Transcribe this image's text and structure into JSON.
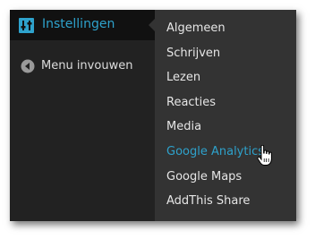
{
  "sidebar": {
    "active_item": {
      "label": "Instellingen",
      "icon": "settings-sliders-icon"
    },
    "items": [
      {
        "label": "Menu invouwen",
        "icon": "collapse-arrow-icon"
      }
    ]
  },
  "submenu": {
    "items": [
      {
        "label": "Algemeen"
      },
      {
        "label": "Schrijven"
      },
      {
        "label": "Lezen"
      },
      {
        "label": "Reacties"
      },
      {
        "label": "Media"
      },
      {
        "label": "Google Analytics"
      },
      {
        "label": "Google Maps"
      },
      {
        "label": "AddThis Share"
      }
    ],
    "highlighted_item": "Google Analytics"
  },
  "colors": {
    "sidebar_bg": "#222222",
    "active_bg": "#111111",
    "submenu_bg": "#333333",
    "accent": "#2ea2cc",
    "text": "#dddddd"
  },
  "pointer": {
    "icon": "hand-pointer-icon"
  }
}
